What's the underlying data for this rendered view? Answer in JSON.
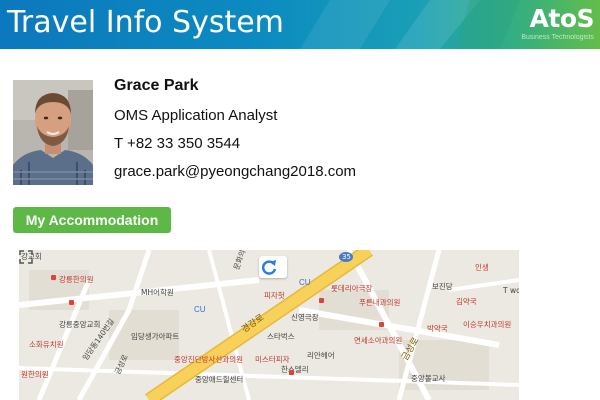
{
  "header": {
    "title": "Travel Info System",
    "logo": {
      "word": "AtoS",
      "tagline": "Business Technologists"
    }
  },
  "profile": {
    "name": "Grace Park",
    "role": "OMS Application Analyst",
    "phone": "T +82 33 350 3544",
    "email": "grace.park@pyeongchang2018.com"
  },
  "accommodation_button": "My Accommodation",
  "map": {
    "controls": {
      "refresh": "refresh-icon",
      "fullscreen": "fullscreen-icon"
    },
    "labels": [
      "강교회",
      "강릉한의원",
      "MH어학원",
      "강릉중앙교회",
      "소화유치원",
      "원한의원",
      "임당동140번길",
      "금성로",
      "CU",
      "임당생가아파트",
      "문화의길",
      "피자헛",
      "CU",
      "35",
      "롯데리아극장",
      "푸른내과의원",
      "신영극장",
      "스타벅스",
      "리안헤어",
      "중앙진단방사선과의원",
      "미스터피자",
      "한스델리",
      "중앙애드힐센터",
      "연세소아과의원",
      "금성로",
      "박약국",
      "중앙볼교사",
      "보진당",
      "김약국",
      "인생",
      "T wo",
      "이승우치과의원",
      "경강로"
    ],
    "colors": {
      "road_major": "#f8d15a",
      "road_minor": "#ffffff",
      "land": "#ece9e2",
      "block": "#e3ded4"
    }
  },
  "colors": {
    "accent": "#5db846",
    "header_blue": "#0c78bd"
  }
}
